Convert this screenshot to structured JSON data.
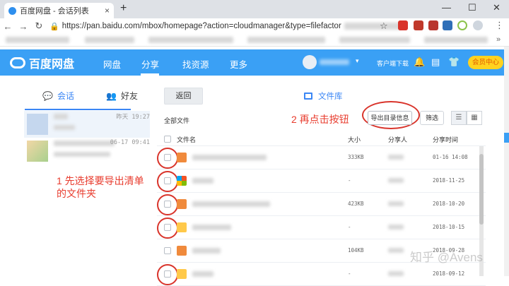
{
  "browser": {
    "tab_title": "百度网盘 - 会话列表",
    "tab_close": "×",
    "new_tab": "+",
    "win_min": "—",
    "win_max": "☐",
    "win_close": "✕",
    "url": "https://pan.baidu.com/mbox/homepage?action=cloudmanager&type=filefactor"
  },
  "header": {
    "logo_text": "百度网盘",
    "nav": [
      "网盘",
      "分享",
      "找资源",
      "更多"
    ],
    "active_nav": "分享",
    "client_download": "客户端下载",
    "member_center": "会员中心"
  },
  "sidebar": {
    "tab_chat": "会话",
    "tab_friends": "好友",
    "conversations": [
      {
        "date": "昨天 19:27"
      },
      {
        "date": "06-17 09:41"
      }
    ]
  },
  "annotations": {
    "step1_line1": "1 先选择要导出清单",
    "step1_line2": "的文件夹",
    "step2": "2 再点击按钮"
  },
  "main": {
    "back_button": "返回",
    "library": "文件库",
    "all_files": "全部文件",
    "export_button": "导出目录信息",
    "filter_button": "筛选",
    "columns": {
      "name": "文件名",
      "size": "大小",
      "sharer": "分享人",
      "time": "分享时间"
    },
    "rows": [
      {
        "icon": "image",
        "size": "333KB",
        "time": "01-16 14:08"
      },
      {
        "icon": "windows",
        "size": "-",
        "time": "2018-11-25"
      },
      {
        "icon": "image",
        "size": "423KB",
        "time": "2018-10-20"
      },
      {
        "icon": "folder",
        "size": "-",
        "time": "2018-10-15"
      },
      {
        "icon": "image",
        "size": "104KB",
        "time": "2018-09-28"
      },
      {
        "icon": "folder",
        "size": "-",
        "time": "2018-09-12"
      }
    ]
  },
  "watermark": "知乎 @Avens",
  "colors": {
    "brand": "#3aa0f5",
    "accent_red": "#d9342b",
    "link_blue": "#3a86f5",
    "vip_yellow": "#ffd21f"
  }
}
